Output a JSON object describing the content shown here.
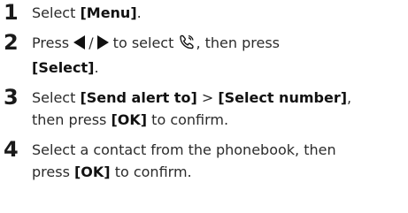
{
  "steps": [
    {
      "number": "1",
      "t1": "Select ",
      "b1": "[Menu]",
      "t2": "."
    },
    {
      "number": "2",
      "t1": "Press ",
      "slash": "/",
      "t2": " to select ",
      "t3": ", then press",
      "b1": "[Select]",
      "t4": ".",
      "icons": [
        "left-arrow-icon",
        "right-arrow-icon",
        "sos-alert-icon"
      ]
    },
    {
      "number": "3",
      "t1": "Select ",
      "b1": "[Send alert to]",
      "t2": " > ",
      "b2": "[Select number]",
      "t3": ",",
      "t4": "then press ",
      "b3": "[OK]",
      "t5": " to confirm."
    },
    {
      "number": "4",
      "t1": "Select a contact from the phonebook, then",
      "t2": "press ",
      "b1": "[OK]",
      "t3": " to confirm."
    }
  ]
}
